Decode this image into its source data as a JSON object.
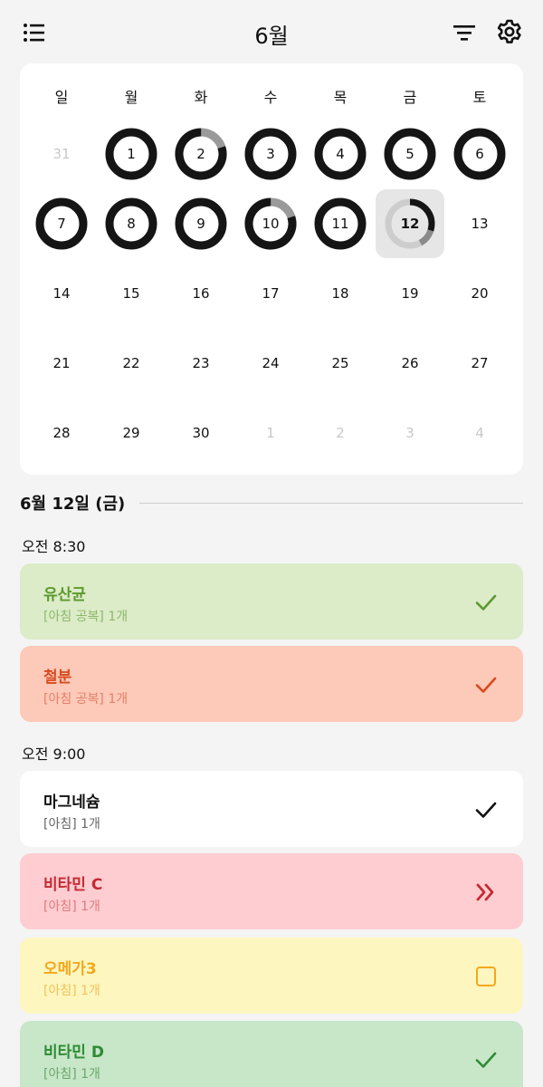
{
  "header": {
    "title": "6월"
  },
  "calendar": {
    "weekdays": [
      "일",
      "월",
      "화",
      "수",
      "목",
      "금",
      "토"
    ],
    "days": [
      {
        "label": "31",
        "muted": true,
        "ring": null
      },
      {
        "label": "1",
        "ring": "full"
      },
      {
        "label": "2",
        "ring": "mostly"
      },
      {
        "label": "3",
        "ring": "full"
      },
      {
        "label": "4",
        "ring": "full"
      },
      {
        "label": "5",
        "ring": "full"
      },
      {
        "label": "6",
        "ring": "full"
      },
      {
        "label": "7",
        "ring": "full"
      },
      {
        "label": "8",
        "ring": "full"
      },
      {
        "label": "9",
        "ring": "full"
      },
      {
        "label": "10",
        "ring": "mostly"
      },
      {
        "label": "11",
        "ring": "full"
      },
      {
        "label": "12",
        "ring": "today",
        "today": true
      },
      {
        "label": "13",
        "ring": null
      },
      {
        "label": "14",
        "ring": null
      },
      {
        "label": "15",
        "ring": null
      },
      {
        "label": "16",
        "ring": null
      },
      {
        "label": "17",
        "ring": null
      },
      {
        "label": "18",
        "ring": null
      },
      {
        "label": "19",
        "ring": null
      },
      {
        "label": "20",
        "ring": null
      },
      {
        "label": "21",
        "ring": null
      },
      {
        "label": "22",
        "ring": null
      },
      {
        "label": "23",
        "ring": null
      },
      {
        "label": "24",
        "ring": null
      },
      {
        "label": "25",
        "ring": null
      },
      {
        "label": "26",
        "ring": null
      },
      {
        "label": "27",
        "ring": null
      },
      {
        "label": "28",
        "ring": null
      },
      {
        "label": "29",
        "ring": null
      },
      {
        "label": "30",
        "ring": null
      },
      {
        "label": "1",
        "muted": true,
        "ring": null
      },
      {
        "label": "2",
        "muted": true,
        "ring": null
      },
      {
        "label": "3",
        "muted": true,
        "ring": null
      },
      {
        "label": "4",
        "muted": true,
        "ring": null
      }
    ]
  },
  "selected_date": "6월 12일 (금)",
  "groups": [
    {
      "time": "오전 8:30",
      "items": [
        {
          "name": "유산균",
          "sub": "[아침 공복] 1개",
          "status": "check",
          "bg": "#dcebc8",
          "fg": "#5a9a2c",
          "sub_color": "#8cb96a"
        },
        {
          "name": "철분",
          "sub": "[아침 공복] 1개",
          "status": "check",
          "bg": "#fdc9b8",
          "fg": "#d84a1f",
          "sub_color": "#e0826a"
        }
      ]
    },
    {
      "time": "오전 9:00",
      "items": [
        {
          "name": "마그네슘",
          "sub": "[아침] 1개",
          "status": "check",
          "bg": "#ffffff",
          "fg": "#111111",
          "sub_color": "#666666"
        },
        {
          "name": "비타민 C",
          "sub": "[아침] 1개",
          "status": "skip",
          "bg": "#fdcdd1",
          "fg": "#c42a33",
          "sub_color": "#e07b80"
        },
        {
          "name": "오메가3",
          "sub": "[아침] 1개",
          "status": "empty",
          "bg": "#fdf6bf",
          "fg": "#f2a81d",
          "sub_color": "#f2c25a"
        },
        {
          "name": "비타민 D",
          "sub": "[아침] 1개",
          "status": "check",
          "bg": "#c8e6c8",
          "fg": "#2e8b34",
          "sub_color": "#6aa76e"
        }
      ]
    }
  ]
}
